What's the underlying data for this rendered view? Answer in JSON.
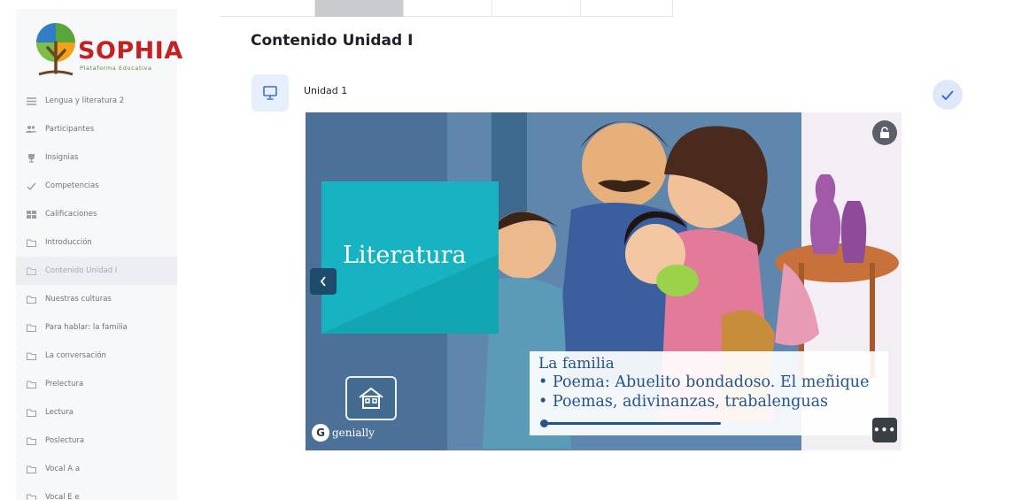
{
  "brand": {
    "name": "SOPHIA",
    "subtitle": "Plataforma Educativa",
    "name_color": "#c32222"
  },
  "sidebar": {
    "items": [
      {
        "label": "Lengua y literatura 2",
        "icon": "menu-icon"
      },
      {
        "label": "Participantes",
        "icon": "users-icon"
      },
      {
        "label": "Insignias",
        "icon": "trophy-icon"
      },
      {
        "label": "Competencias",
        "icon": "check-icon"
      },
      {
        "label": "Calificaciones",
        "icon": "grid-icon"
      },
      {
        "label": "Introducción",
        "icon": "folder-icon"
      },
      {
        "label": "Contenido Unidad I",
        "icon": "folder-icon",
        "active": true
      },
      {
        "label": "Nuestras culturas",
        "icon": "folder-icon"
      },
      {
        "label": "Para hablar: la familia",
        "icon": "folder-icon"
      },
      {
        "label": "La conversación",
        "icon": "folder-icon"
      },
      {
        "label": "Prelectura",
        "icon": "folder-icon"
      },
      {
        "label": "Lectura",
        "icon": "folder-icon"
      },
      {
        "label": "Poslectura",
        "icon": "folder-icon"
      },
      {
        "label": "Vocal A a",
        "icon": "folder-icon"
      },
      {
        "label": "Vocal E e",
        "icon": "folder-icon"
      }
    ]
  },
  "main": {
    "title": "Contenido Unidad I",
    "activity": {
      "name": "Unidad 1",
      "icon": "presentation-icon",
      "completed": true
    }
  },
  "presentation": {
    "card_title": "Literatura",
    "lines": [
      "La familia",
      "• Poema: Abuelito bondadoso. El meñique",
      "• Poemas, adivinanzas, trabalenguas"
    ],
    "brand": "genially",
    "brand_mark": "G",
    "more_label": "•••",
    "colors": {
      "card": "#17b3c2",
      "text": "#23548a",
      "nav_button": "#1e4a6b"
    }
  }
}
